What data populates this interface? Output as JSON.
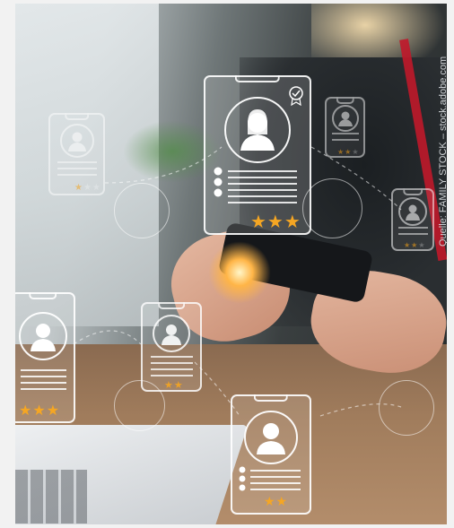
{
  "image": {
    "alt": "Hands holding a smartphone with floating candidate profile cards",
    "credit": "Quelle: FAMILY STOCK – stock.adobe.com"
  },
  "cards": [
    {
      "name": "profile-card-featured",
      "stars_filled": 3,
      "stars_total": 3,
      "verified": true
    },
    {
      "name": "profile-card-left",
      "stars_filled": 3,
      "stars_total": 3
    },
    {
      "name": "profile-card-center",
      "stars_filled": 2,
      "stars_total": 2
    },
    {
      "name": "profile-card-bottom",
      "stars_filled": 2,
      "stars_total": 2
    },
    {
      "name": "profile-card-top-left",
      "stars_filled": 1,
      "stars_total": 3
    },
    {
      "name": "profile-card-top-right",
      "stars_filled": 2,
      "stars_total": 3
    },
    {
      "name": "profile-card-right",
      "stars_filled": 2,
      "stars_total": 3
    }
  ],
  "colors": {
    "star": "#f5a623",
    "lanyard": "#c0182a"
  }
}
